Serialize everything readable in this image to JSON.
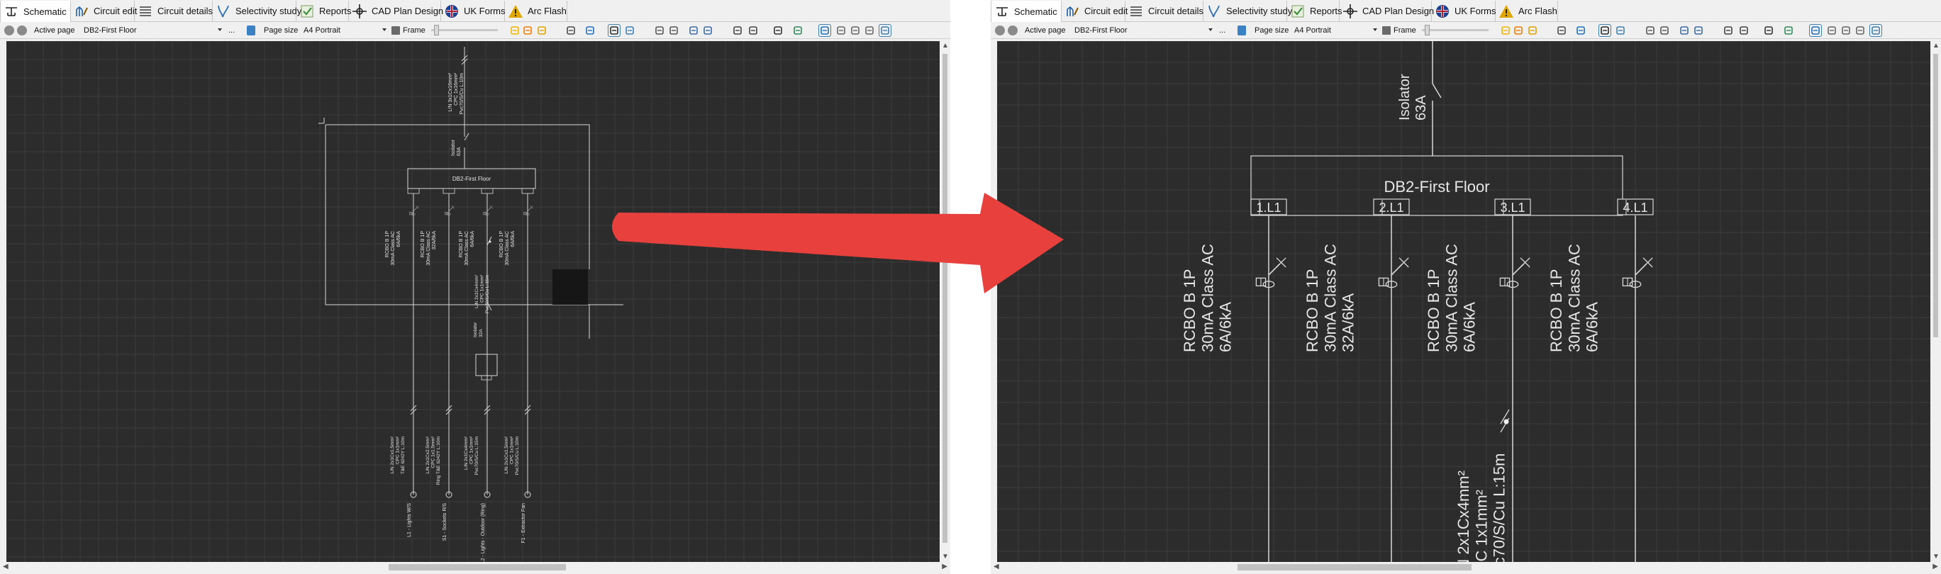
{
  "tabs": [
    {
      "label": "Schematic",
      "icon": "schematic-icon",
      "active": true
    },
    {
      "label": "Circuit edit",
      "icon": "circuit-edit-icon",
      "active": false
    },
    {
      "label": "Circuit details",
      "icon": "circuit-details-icon",
      "active": false
    },
    {
      "label": "Selectivity study",
      "icon": "selectivity-icon",
      "active": false
    },
    {
      "label": "Reports",
      "icon": "reports-icon",
      "active": false
    },
    {
      "label": "CAD Plan Design",
      "icon": "cad-plan-icon",
      "active": false
    },
    {
      "label": "UK Forms",
      "icon": "uk-flag-icon",
      "active": false
    },
    {
      "label": "Arc Flash",
      "icon": "arc-flash-warning-icon",
      "active": false
    }
  ],
  "toolbar": {
    "active_page_label": "Active page",
    "active_page_value": "DB2-First Floor",
    "ellipsis": "...",
    "page_size_label": "Page size",
    "page_size_value": "A4 Portrait",
    "frame_label": "Frame"
  },
  "colors": {
    "canvas_bg": "#2c2c2c",
    "grid": "#3b3b3b",
    "wiring": "#d8d8d8",
    "arrow": "#e8403c",
    "selected_tool_border": "#3c7fb1"
  },
  "board": {
    "name": "DB2-First Floor",
    "isolator": {
      "name": "Isolator",
      "rating": "63A"
    },
    "incoming_cable": [
      "L/N 3x1Cx16mm²",
      "CPC 1x16mm²",
      "Pvc70/S/Cu L:10m"
    ],
    "ways": [
      {
        "way": "1.L1",
        "device": [
          "RCBO B 1P",
          "30mA Class AC",
          "6A/6kA"
        ],
        "cable": [
          "L/N 2x1Cx1.5mm²",
          "CPC 1x1mm²",
          "T&E 6242Y L:10m"
        ],
        "load": "L1 - Lights W/S"
      },
      {
        "way": "2.L1",
        "device": [
          "RCBO B 1P",
          "30mA Class AC",
          "32A/6kA"
        ],
        "cable": [
          "L/N 2x1Cx2.5mm²",
          "CPC 1x1.5mm²",
          "Ring T&E 6242Y L:10m"
        ],
        "load": "S1 - Sockets R/S"
      },
      {
        "way": "3.L1",
        "device": [
          "RCBO B 1P",
          "30mA Class AC",
          "6A/6kA"
        ],
        "cable": [
          "L/N 2x1Cx4mm²",
          "CPC 1x1mm²",
          "Pvc70/S/Cu L:15m"
        ],
        "load": "L2 - Lights - Outdoor (Ring)"
      },
      {
        "way": "4.L1",
        "device": [
          "RCBO B 1P",
          "30mA Class AC",
          "6A/6kA"
        ],
        "cable": [
          "L/N 2x1Cx1.5mm²",
          "CPC 1x1mm²",
          "Pvc70/S/Cu L:10m"
        ],
        "load": "F1 - Extractor Fan"
      }
    ],
    "sub_isolator": {
      "name": "Isolator",
      "rating": "32A"
    },
    "sub_cable": [
      "L/N 2x1Cx4mm²",
      "CPC 1x1mm²",
      "Pvc70/S/Cu L:15m"
    ]
  }
}
